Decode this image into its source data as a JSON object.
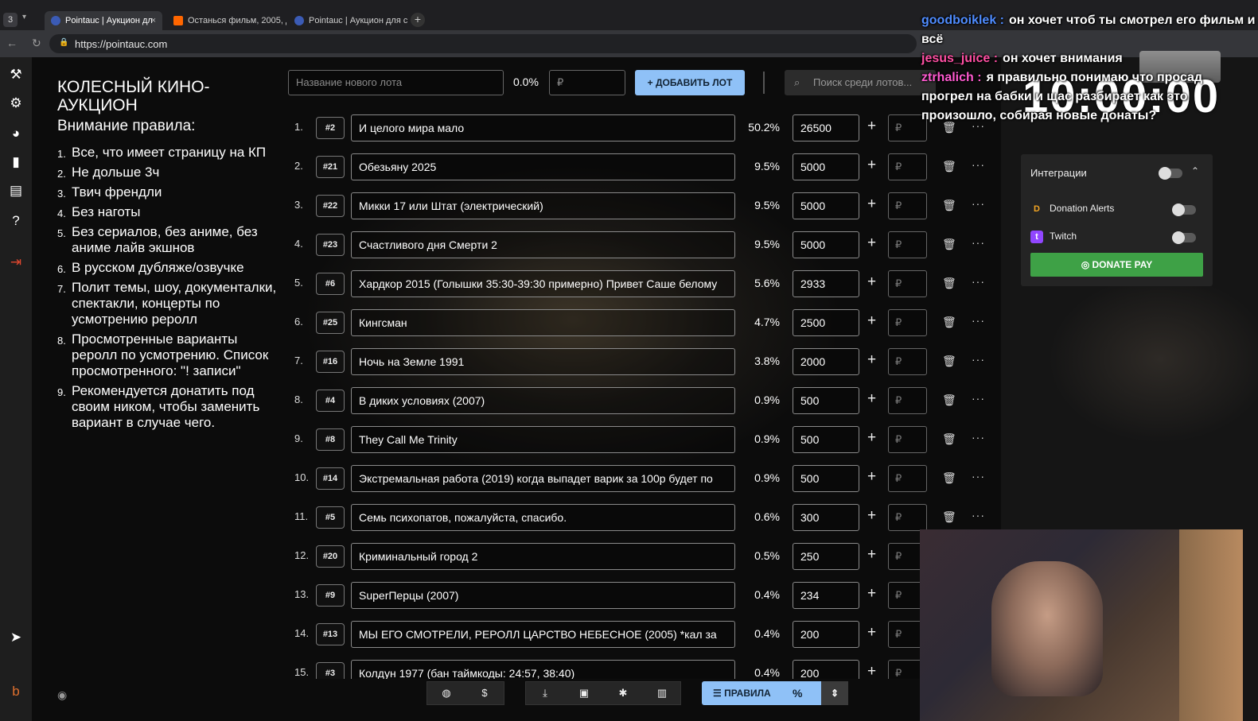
{
  "browser": {
    "window_count": "3",
    "tabs": [
      {
        "title": "Pointauc | Аукцион дл",
        "active": true
      },
      {
        "title": "Останься фильм, 2005, д",
        "active": false
      },
      {
        "title": "Pointauc | Аукцион для с",
        "active": false
      }
    ],
    "url": "https://pointauc.com"
  },
  "sidebar": {
    "app_title": "КОЛЕСНЫЙ КИНО-АУКЦИОН",
    "rules_heading": "Внимание правила:",
    "rules": [
      "Все, что имеет страницу на КП",
      "Не дольше 3ч",
      "Твич френдли",
      "Без наготы",
      "Без сериалов, без аниме, без аниме лайв экшнов",
      "В русском дубляже/озвучке",
      "Полит темы, шоу, документалки, спектакли, концерты по усмотрению реролл",
      "Просмотренные варианты реролл по усмотрению. Список просмотренного: \"! записи\"",
      "Рекомендуется донатить под своим ником, чтобы заменить вариант в случае чего."
    ]
  },
  "new_lot": {
    "name_placeholder": "Название нового лота",
    "percent": "0.0%",
    "amount_placeholder": "₽",
    "add_label": "ДОБАВИТЬ ЛОТ"
  },
  "search": {
    "placeholder": "Поиск среди лотов..."
  },
  "lots": [
    {
      "index": "1.",
      "id": "#2",
      "name": "И целого мира мало",
      "percent": "50.2%",
      "amount": "26500"
    },
    {
      "index": "2.",
      "id": "#21",
      "name": "Обезьяну 2025",
      "percent": "9.5%",
      "amount": "5000"
    },
    {
      "index": "3.",
      "id": "#22",
      "name": "Микки 17 или Штат (электрический)",
      "percent": "9.5%",
      "amount": "5000"
    },
    {
      "index": "4.",
      "id": "#23",
      "name": "Счастливого дня Смерти 2",
      "percent": "9.5%",
      "amount": "5000"
    },
    {
      "index": "5.",
      "id": "#6",
      "name": "Хардкор 2015 (Голышки 35:30-39:30 примерно) Привет Саше белому",
      "percent": "5.6%",
      "amount": "2933"
    },
    {
      "index": "6.",
      "id": "#25",
      "name": "Кингсман",
      "percent": "4.7%",
      "amount": "2500"
    },
    {
      "index": "7.",
      "id": "#16",
      "name": "Ночь на Земле 1991",
      "percent": "3.8%",
      "amount": "2000"
    },
    {
      "index": "8.",
      "id": "#4",
      "name": "В диких условиях (2007)",
      "percent": "0.9%",
      "amount": "500"
    },
    {
      "index": "9.",
      "id": "#8",
      "name": "They Call Me Trinity",
      "percent": "0.9%",
      "amount": "500"
    },
    {
      "index": "10.",
      "id": "#14",
      "name": "Экстремальная работа (2019) когда выпадет варик за 100р будет по",
      "percent": "0.9%",
      "amount": "500"
    },
    {
      "index": "11.",
      "id": "#5",
      "name": "Семь психопатов, пожалуйста, спасибо.",
      "percent": "0.6%",
      "amount": "300"
    },
    {
      "index": "12.",
      "id": "#20",
      "name": "Криминальный город 2",
      "percent": "0.5%",
      "amount": "250"
    },
    {
      "index": "13.",
      "id": "#9",
      "name": "SuperПерцы (2007)",
      "percent": "0.4%",
      "amount": "234"
    },
    {
      "index": "14.",
      "id": "#13",
      "name": "МЫ ЕГО СМОТРЕЛИ, РЕРОЛЛ ЦАРСТВО НЕБЕСНОЕ (2005) *кал за",
      "percent": "0.4%",
      "amount": "200"
    },
    {
      "index": "15.",
      "id": "#3",
      "name": "Колдун 1977 (бан таймкоды: 24:57, 38:40)",
      "percent": "0.4%",
      "amount": "200"
    }
  ],
  "lot_rub_placeholder": "₽",
  "integrations": {
    "title": "Интеграции",
    "items": [
      "Donation Alerts",
      "Twitch"
    ],
    "donate_label": "DONATE PAY"
  },
  "toolbar": {
    "rules_label": "ПРАВИЛА",
    "percent_symbol": "%"
  },
  "chat": [
    {
      "user": "goodboiklek :",
      "text": "он хочет чтоб ты смотрел его фильм и всё",
      "color": "#4f8cff"
    },
    {
      "user": "jesus_juice :",
      "text": "он хочет внимания",
      "color": "#ff4fa3"
    },
    {
      "user": "ztrhalich :",
      "text": "я правильно понимаю что просад прогрел на бабки и щас разбирает как это произошло, собирая новые донаты?",
      "color": "#ff5ad0"
    }
  ],
  "timer": "10:00:00",
  "colors": {
    "accent_button": "#8fc1f7",
    "donate_green": "#3ea146"
  }
}
